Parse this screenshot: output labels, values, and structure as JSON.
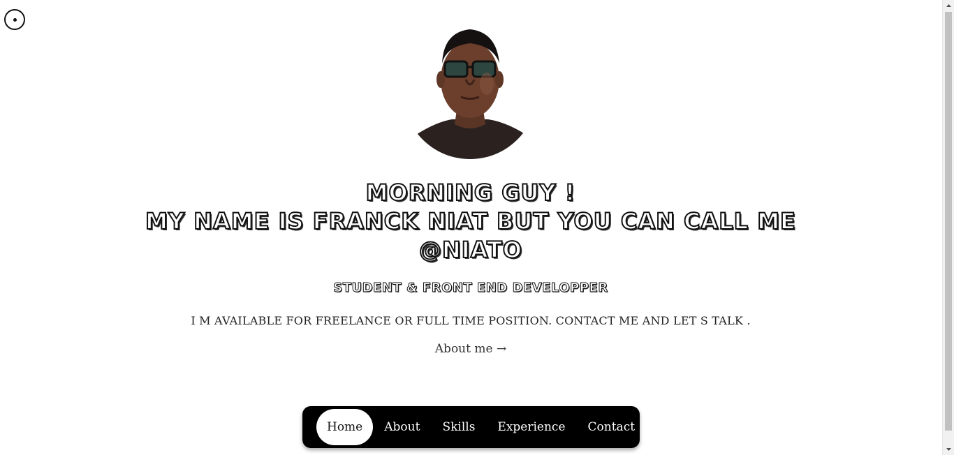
{
  "header": {
    "cursor_toggle_icon": "circle-dot-icon"
  },
  "profile": {
    "avatar_alt": "portrait-photo"
  },
  "hero": {
    "line1": "MORNING GUY !",
    "line2": "MY NAME IS FRANCK NIAT BUT YOU CAN CALL ME",
    "line3": "@NIATO",
    "role": "STUDENT & FRONT END DEVELOPPER",
    "availability": "I M AVAILABLE FOR FREELANCE OR FULL TIME POSITION. CONTACT ME AND LET S TALK .",
    "about_link": "About me →"
  },
  "nav": {
    "items": [
      {
        "label": "Home",
        "active": true
      },
      {
        "label": "About"
      },
      {
        "label": "Skills"
      },
      {
        "label": "Experience"
      },
      {
        "label": "Contact"
      }
    ]
  },
  "colors": {
    "background": "#ffffff",
    "nav_background": "#000000",
    "nav_active": "#ffffff",
    "text": "#222222"
  }
}
